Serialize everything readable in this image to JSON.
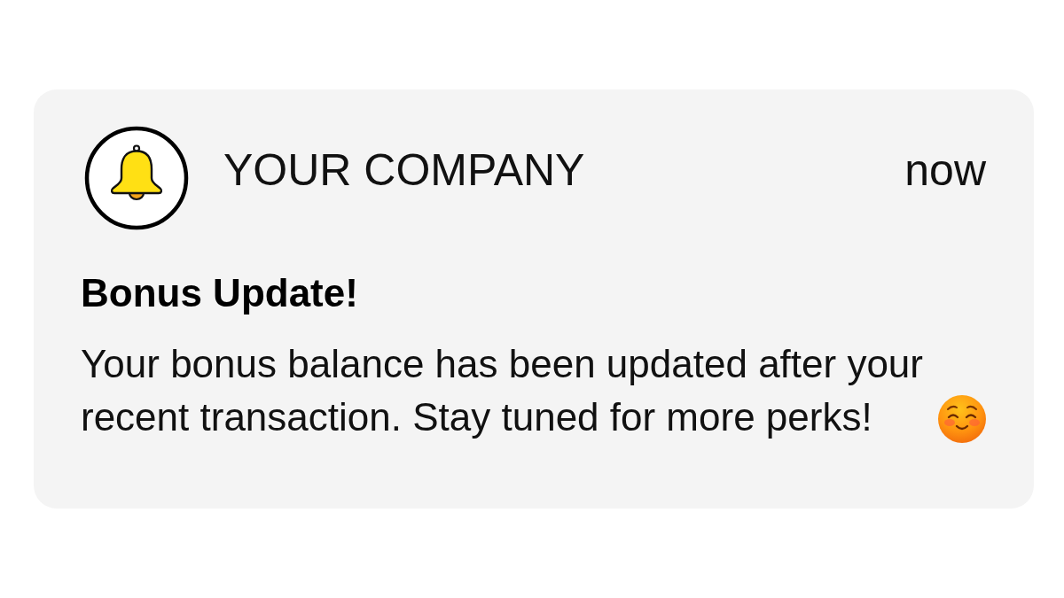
{
  "notification": {
    "app_name": "YOUR COMPANY",
    "time": "now",
    "title": "Bonus Update!",
    "message": "Your bonus balance has been updated after your recent transaction. Stay tuned for more perks!"
  }
}
